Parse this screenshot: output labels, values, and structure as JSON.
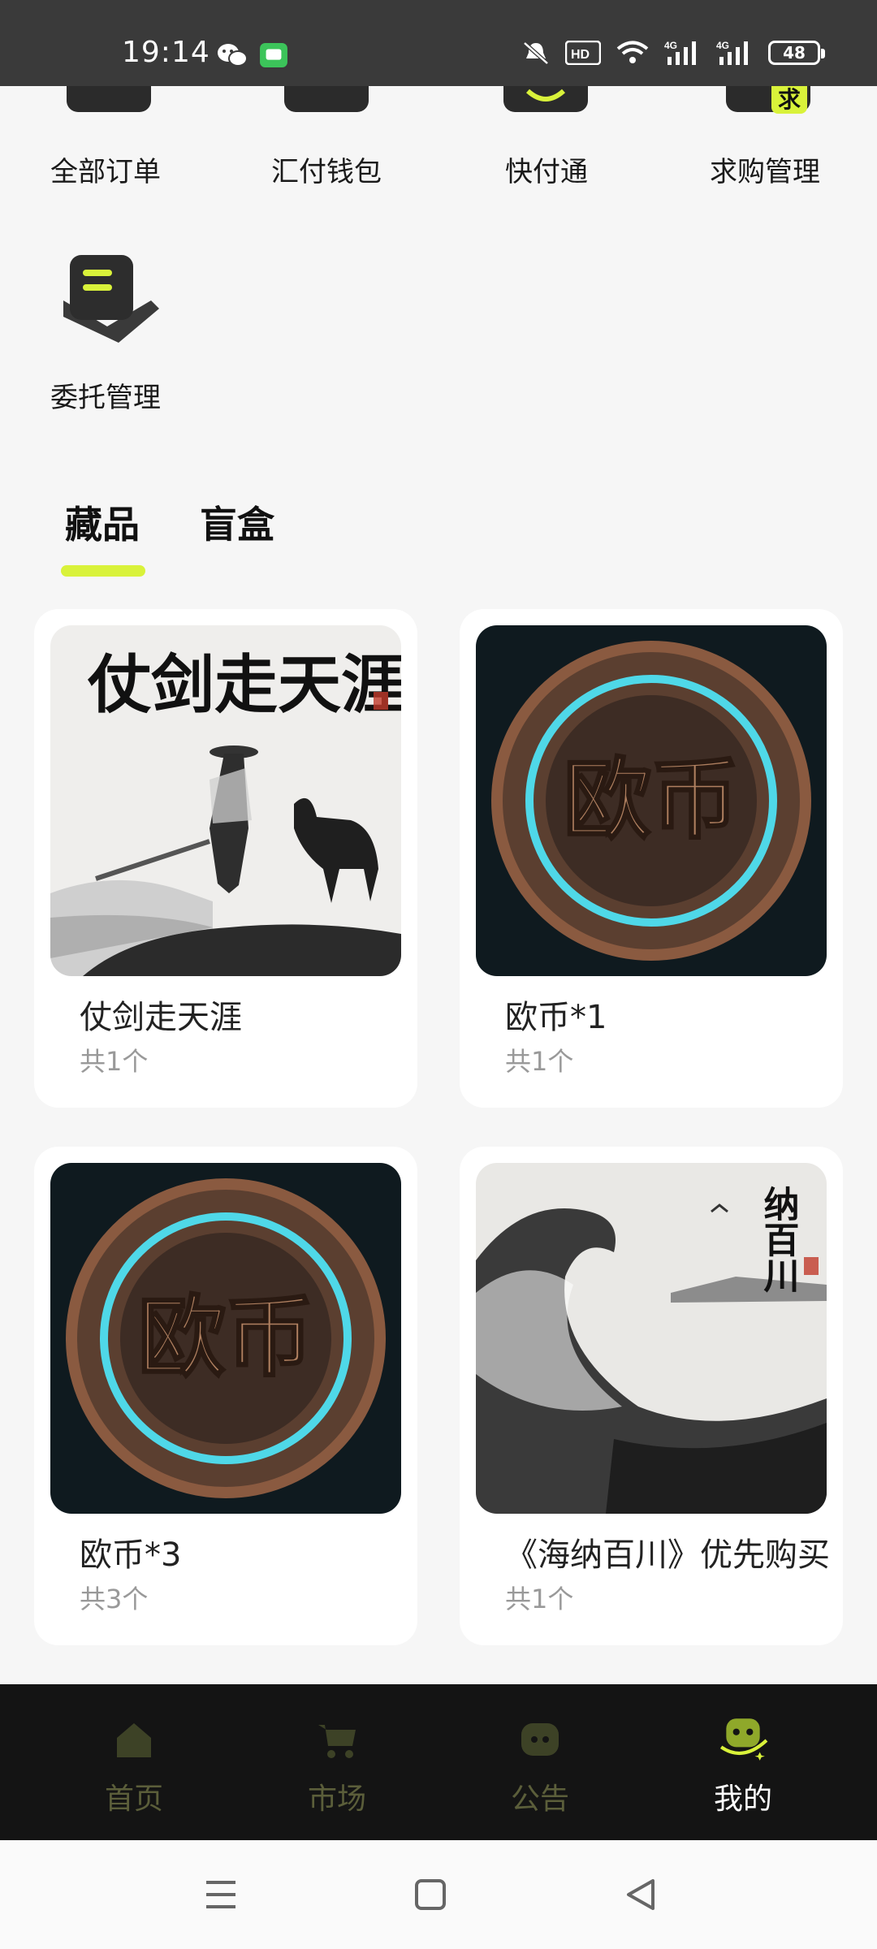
{
  "status_bar": {
    "time": "19:14",
    "battery": "48",
    "network_labels": [
      "HD2",
      "4G",
      "4G"
    ]
  },
  "quick_actions": [
    {
      "label": "全部订单",
      "icon": "orders-icon"
    },
    {
      "label": "汇付钱包",
      "icon": "wallet-icon"
    },
    {
      "label": "快付通",
      "icon": "quick-pay-icon"
    },
    {
      "label": "求购管理",
      "icon": "purchase-request-icon",
      "badge": "求"
    },
    {
      "label": "委托管理",
      "icon": "entrust-icon"
    }
  ],
  "tabs": [
    {
      "label": "藏品",
      "active": true
    },
    {
      "label": "盲盒",
      "active": false
    }
  ],
  "collections": [
    {
      "title": "仗剑走天涯",
      "count": "共1个",
      "image": "swordsman-ink-painting",
      "art_text": "仗剑走天涯"
    },
    {
      "title": "欧币*1",
      "count": "共1个",
      "image": "euro-coin",
      "art_text": "欧币"
    },
    {
      "title": "欧币*3",
      "count": "共3个",
      "image": "euro-coin",
      "art_text": "欧币"
    },
    {
      "title": "《海纳百川》优先购买",
      "count": "共1个",
      "image": "wave-ink-painting",
      "art_text": "纳百川"
    }
  ],
  "bottom_nav": [
    {
      "label": "首页",
      "icon": "home-icon",
      "active": false
    },
    {
      "label": "市场",
      "icon": "cart-icon",
      "active": false
    },
    {
      "label": "公告",
      "icon": "chat-icon",
      "active": false
    },
    {
      "label": "我的",
      "icon": "profile-icon",
      "active": true
    }
  ],
  "colors": {
    "accent": "#d9f23a",
    "nav_bg": "#141414",
    "nav_inactive": "#5b5e3a",
    "status_bar_bg": "#3a3a3a"
  }
}
